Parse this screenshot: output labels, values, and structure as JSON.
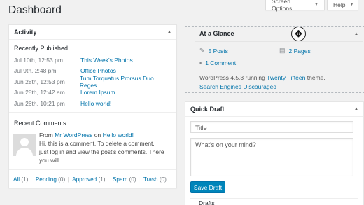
{
  "page": {
    "title": "Dashboard"
  },
  "header_buttons": {
    "screen_options": "Screen Options",
    "help": "Help"
  },
  "activity": {
    "title": "Activity",
    "recently_published_label": "Recently Published",
    "posts": [
      {
        "date": "Jul 10th, 12:53 pm",
        "title": "This Week's Photos"
      },
      {
        "date": "Jul 9th, 2:48 pm",
        "title": "Office Photos"
      },
      {
        "date": "Jun 28th, 12:53 pm",
        "title": "Tum Torquatus Prorsus Duo Reges"
      },
      {
        "date": "Jun 28th, 12:42 am",
        "title": "Lorem Ipsum"
      },
      {
        "date": "Jun 26th, 10:21 pm",
        "title": "Hello world!"
      }
    ],
    "recent_comments_label": "Recent Comments",
    "comment": {
      "from_label": "From",
      "author": "Mr WordPress",
      "on_label": "on",
      "post": "Hello world!",
      "excerpt": "Hi, this is a comment. To delete a comment, just log in and view the post's comments. There you will…"
    },
    "filters": [
      {
        "label": "All",
        "count": "(1)"
      },
      {
        "label": "Pending",
        "count": "(0)"
      },
      {
        "label": "Approved",
        "count": "(1)"
      },
      {
        "label": "Spam",
        "count": "(0)"
      },
      {
        "label": "Trash",
        "count": "(0)"
      }
    ]
  },
  "at_a_glance": {
    "title": "At a Glance",
    "posts_count": "5 Posts",
    "pages_count": "2 Pages",
    "comments_count": "1 Comment",
    "info_prefix": "WordPress 4.5.3 running",
    "theme": "Twenty Fifteen",
    "info_suffix": "theme.",
    "search_engines": "Search Engines Discouraged"
  },
  "quick_draft": {
    "title": "Quick Draft",
    "title_placeholder": "Title",
    "content_placeholder": "What's on your mind?",
    "save_label": "Save Draft",
    "drafts_peek": "Drafts"
  },
  "icons": {
    "collapse": "triangle-up",
    "posts": "pushpin",
    "pages": "document",
    "comments": "speech-bubble"
  }
}
